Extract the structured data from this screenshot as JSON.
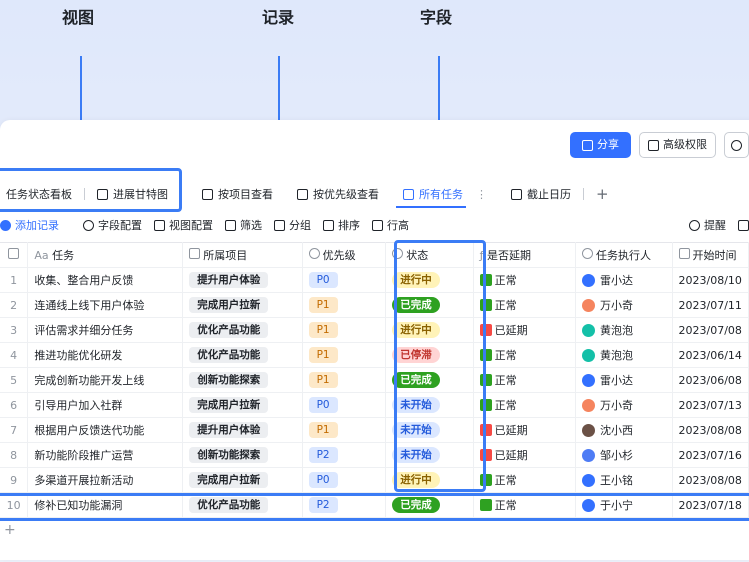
{
  "annotations": {
    "view": "视图",
    "record": "记录",
    "field": "字段"
  },
  "topbar": {
    "share": "分享",
    "perm": "高级权限"
  },
  "tabs": [
    {
      "label": "任务状态看板"
    },
    {
      "label": "进展甘特图"
    },
    {
      "label": "按项目查看"
    },
    {
      "label": "按优先级查看"
    },
    {
      "label": "所有任务"
    },
    {
      "label": "截止日历"
    }
  ],
  "toolbar": {
    "add": "添加记录",
    "fields": "字段配置",
    "view": "视图配置",
    "filter": "筛选",
    "group": "分组",
    "sort": "排序",
    "row": "行高",
    "remind": "提醒"
  },
  "headers": {
    "task": "任务",
    "project": "所属项目",
    "priority": "优先级",
    "status": "状态",
    "delay": "是否延期",
    "owner": "任务执行人",
    "start": "开始时间"
  },
  "colors": {
    "accent": "#3370ff",
    "done": "#2ea121",
    "highlight": "#3b7cf5"
  },
  "rows": [
    {
      "n": "1",
      "task": "收集、整合用户反馈",
      "project": "提升用户体验",
      "priority": "P0",
      "status": "进行中",
      "delay": "正常",
      "owner": "雷小达",
      "start": "2023/08/10"
    },
    {
      "n": "2",
      "task": "连通线上线下用户体验",
      "project": "完成用户拉新",
      "priority": "P1",
      "status": "已完成",
      "delay": "正常",
      "owner": "万小奇",
      "start": "2023/07/11"
    },
    {
      "n": "3",
      "task": "评估需求并细分任务",
      "project": "优化产品功能",
      "priority": "P1",
      "status": "进行中",
      "delay": "已延期",
      "owner": "黄泡泡",
      "start": "2023/07/08"
    },
    {
      "n": "4",
      "task": "推进功能优化研发",
      "project": "优化产品功能",
      "priority": "P1",
      "status": "已停滞",
      "delay": "正常",
      "owner": "黄泡泡",
      "start": "2023/06/14"
    },
    {
      "n": "5",
      "task": "完成创新功能开发上线",
      "project": "创新功能探索",
      "priority": "P1",
      "status": "已完成",
      "delay": "正常",
      "owner": "雷小达",
      "start": "2023/06/08"
    },
    {
      "n": "6",
      "task": "引导用户加入社群",
      "project": "完成用户拉新",
      "priority": "P0",
      "status": "未开始",
      "delay": "正常",
      "owner": "万小奇",
      "start": "2023/07/13"
    },
    {
      "n": "7",
      "task": "根据用户反馈迭代功能",
      "project": "提升用户体验",
      "priority": "P1",
      "status": "未开始",
      "delay": "已延期",
      "owner": "沈小西",
      "start": "2023/08/08"
    },
    {
      "n": "8",
      "task": "新功能阶段推广运营",
      "project": "创新功能探索",
      "priority": "P2",
      "status": "未开始",
      "delay": "已延期",
      "owner": "邹小杉",
      "start": "2023/07/16"
    },
    {
      "n": "9",
      "task": "多渠道开展拉新活动",
      "project": "完成用户拉新",
      "priority": "P0",
      "status": "进行中",
      "delay": "正常",
      "owner": "王小铭",
      "start": "2023/08/08"
    },
    {
      "n": "10",
      "task": "修补已知功能漏洞",
      "project": "优化产品功能",
      "priority": "P2",
      "status": "已完成",
      "delay": "正常",
      "owner": "于小宁",
      "start": "2023/07/18"
    }
  ]
}
